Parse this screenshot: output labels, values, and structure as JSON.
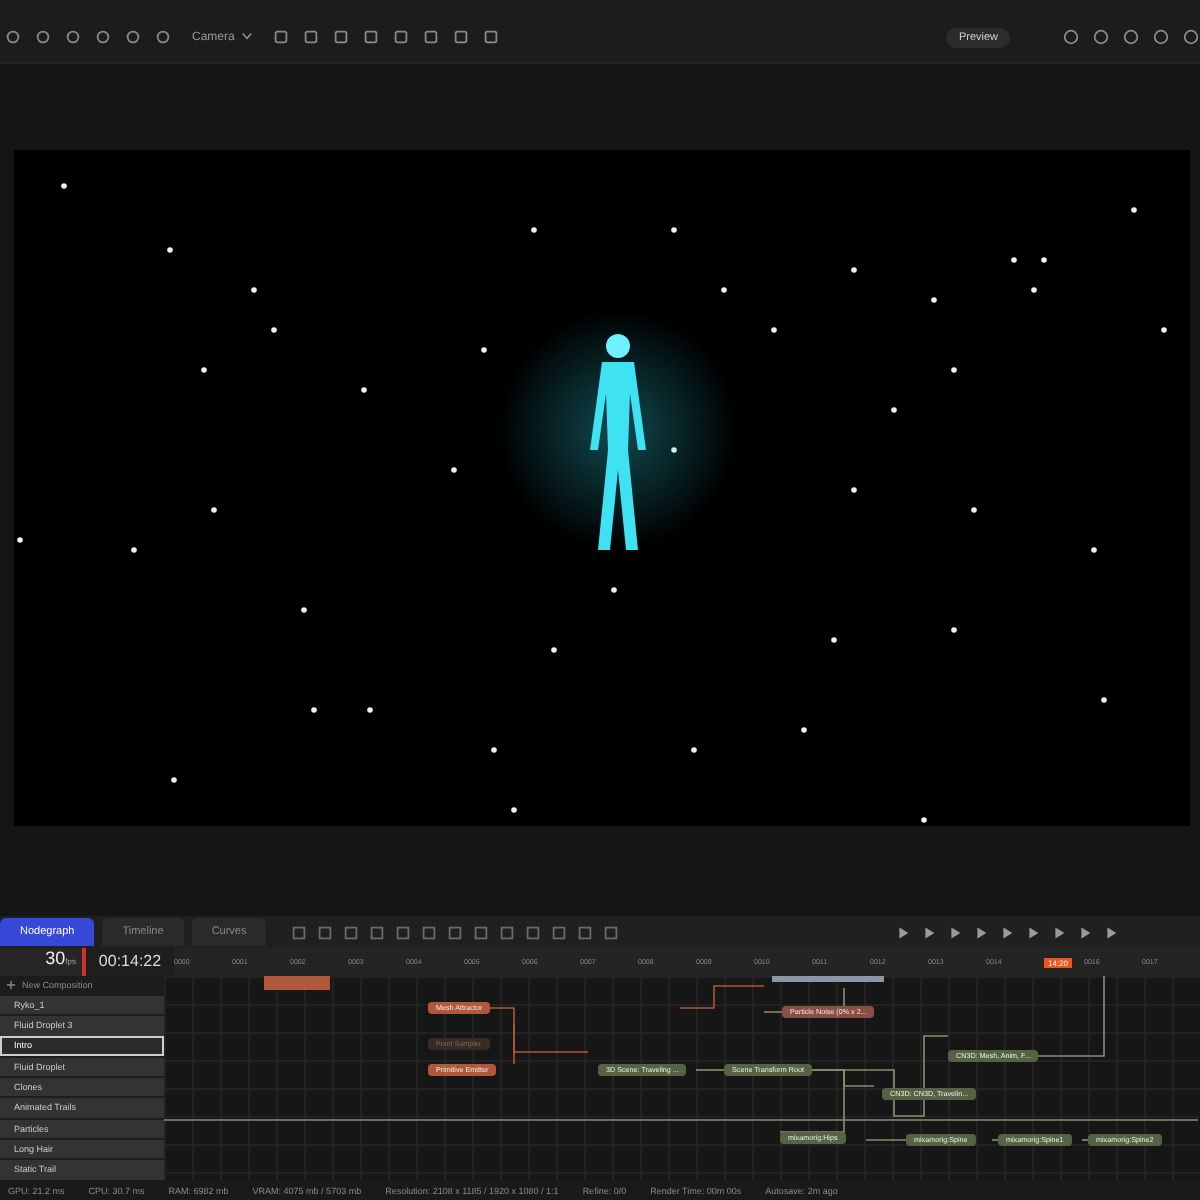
{
  "toolbar": {
    "camera_dropdown": "Camera",
    "preview_button": "Preview"
  },
  "tabs": [
    {
      "label": "Nodegraph",
      "selected": true
    },
    {
      "label": "Timeline",
      "selected": false
    },
    {
      "label": "Curves",
      "selected": false
    }
  ],
  "timeline": {
    "fps": "30",
    "fps_unit": "fps",
    "timecode": "00:14:22",
    "ruler": [
      "0000",
      "0001",
      "0002",
      "0003",
      "0004",
      "0005",
      "0006",
      "0007",
      "0008",
      "0009",
      "0010",
      "0011",
      "0012",
      "0013",
      "0014",
      "0016",
      "0017"
    ],
    "playhead": {
      "label": "14:20",
      "level": 0.88
    }
  },
  "compositions": {
    "new_label": "New Composition",
    "items": [
      {
        "name": "Ryko_1",
        "selected": false
      },
      {
        "name": "Fluid Droplet 3",
        "selected": false
      },
      {
        "name": "Intro",
        "selected": true
      },
      {
        "name": "Fluid Droplet",
        "selected": false
      },
      {
        "name": "Clones",
        "selected": false
      },
      {
        "name": "Animated Trails",
        "selected": false
      },
      {
        "name": "Particles",
        "selected": false
      },
      {
        "name": "Long Hair",
        "selected": false
      },
      {
        "name": "Static Trail",
        "selected": false
      }
    ]
  },
  "nodes": [
    {
      "label": "Mesh Attractor",
      "kind": "particle"
    },
    {
      "label": "Point Sampler",
      "kind": "disabled"
    },
    {
      "label": "Primitive Emitter",
      "kind": "particle"
    },
    {
      "label": "Particle Noise (0% x 2...",
      "kind": "modifier"
    },
    {
      "label": "3D Scene: Traveling ...",
      "kind": "scene"
    },
    {
      "label": "Scene Transform Root",
      "kind": "scene"
    },
    {
      "label": "CN3D: Mesh, Anim, F...",
      "kind": "scene"
    },
    {
      "label": "CN3D: CN3D, Travelin...",
      "kind": "scene"
    },
    {
      "label": "mixamorig:Hips",
      "kind": "scene"
    },
    {
      "label": "mixamorig:Spine",
      "kind": "scene"
    },
    {
      "label": "mixamorig:Spine1",
      "kind": "scene"
    },
    {
      "label": "mixamorig:Spine2",
      "kind": "scene"
    }
  ],
  "status_bar": [
    "GPU: 21.2 ms",
    "CPU: 30.7 ms",
    "RAM: 6982 mb",
    "VRAM: 4075 mb / 5703 mb",
    "Resolution: 2108 x 1185 / 1920 x 1080 / 1:1",
    "Refine: 0/0",
    "Render Time: 00m 00s",
    "Autosave: 2m ago"
  ]
}
